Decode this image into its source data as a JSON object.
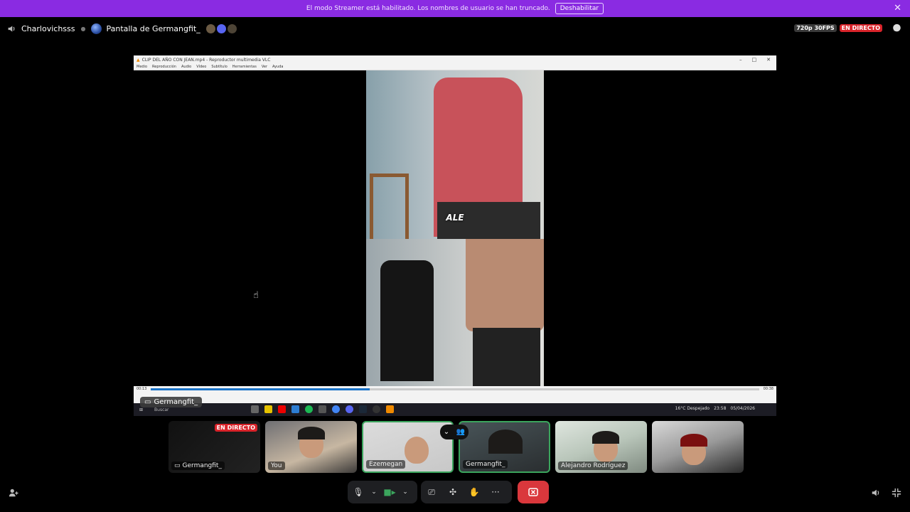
{
  "banner": {
    "text": "El modo Streamer está habilitado. Los nombres de usuario se han truncado.",
    "button": "Deshabilitar"
  },
  "topbar": {
    "user": "Charlovichsss",
    "stream_title": "Pantalla de Germangfit_",
    "quality": "720p 30FPS",
    "live": "EN DIRECTO"
  },
  "stage": {
    "window_title": "CLIP DEL AÑO CON JEAN.mp4 - Reproductor multimedia VLC",
    "menu": [
      "Medio",
      "Reproducción",
      "Audio",
      "Vídeo",
      "Subtítulo",
      "Herramientas",
      "Ver",
      "Ayuda"
    ],
    "overlay_text": "ALE",
    "time_current": "00:13",
    "time_total": "00:38",
    "progress": 0.36,
    "taskbar_search": "Buscar",
    "weather": "16°C  Despejado",
    "clock_time": "23:58",
    "clock_date": "05/04/2026",
    "label": "Germangfit_"
  },
  "tiles": [
    {
      "name": "Germangfit_",
      "live": "EN DIRECTO",
      "screen": true
    },
    {
      "name": "You"
    },
    {
      "name": "Ezemegan"
    },
    {
      "name": "Germangfit_"
    },
    {
      "name": "Alejandro Rodríguez"
    },
    {
      "name": ""
    }
  ],
  "colors": {
    "banner": "#8a2be2",
    "live": "#d9232a",
    "end_call": "#da373c",
    "speaking": "#3ba55d"
  }
}
